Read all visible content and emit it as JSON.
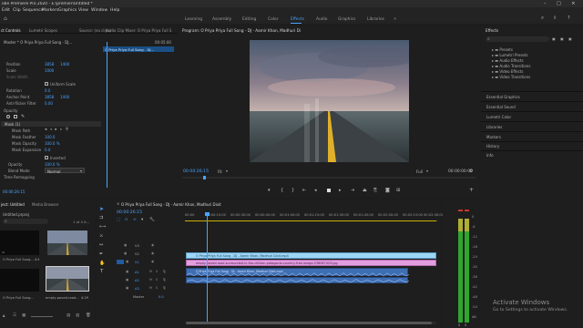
{
  "titlebar": {
    "title": "obe Premiere Pro 2020 - E:\\premier\\Untitled *"
  },
  "menu": [
    "Edit",
    "Clip",
    "Sequence",
    "Markers",
    "Graphics",
    "View",
    "Window",
    "Help"
  ],
  "workspaces": {
    "tabs": [
      "Learning",
      "Assembly",
      "Editing",
      "Color",
      "Effects",
      "Audio",
      "Graphics",
      "Libraries"
    ],
    "active": "Effects"
  },
  "effect_controls": {
    "tabs": [
      "ct Controls",
      "Lumetri Scopes",
      "Source: (no clips)",
      "Audio Clip Mixer: O Priya Priya Full S"
    ],
    "master": "Master * O Priya Priya Full Song - DJ...",
    "clip": "O Priya Priya Full Song - DJ...",
    "timecode": "00:05:00",
    "rows": [
      {
        "label": "Position",
        "v1": "3858",
        "v2": "1400"
      },
      {
        "label": "Scale",
        "v1": "1000",
        "v2": ""
      },
      {
        "label": "Scale Width",
        "v1": "",
        "v2": ""
      },
      {
        "label": "",
        "v1": "",
        "v2": "Uniform Scale"
      },
      {
        "label": "Rotation",
        "v1": "0.0",
        "v2": ""
      },
      {
        "label": "Anchor Point",
        "v1": "3858",
        "v2": "1400"
      },
      {
        "label": "Anti-flicker Filter",
        "v1": "0.00",
        "v2": ""
      }
    ],
    "opacity_label": "Opacity",
    "mask_label": "Mask (1)",
    "mask_rows": [
      {
        "label": "Mask Path",
        "v": ""
      },
      {
        "label": "Mask Feather",
        "v": "100.0"
      },
      {
        "label": "Mask Opacity",
        "v": "100.0 %"
      },
      {
        "label": "Mask Expansion",
        "v": "0.0"
      },
      {
        "label": "",
        "v": "Inverted"
      }
    ],
    "opacity_value_label": "Opacity",
    "opacity_value": "100.0 %",
    "blend_label": "Blend Mode",
    "blend_value": "Normal",
    "time_remap": "Time Remapping",
    "bottom_time": "00:00:26:15"
  },
  "program": {
    "title": "Program: O Priya Priya Full Song - DJ - Aamir Khan, Madhuri Dixit",
    "timecode": "00:00:26:15",
    "fit": "Fit",
    "quality": "Full",
    "duration": "00:00:00:00"
  },
  "project": {
    "tabs": [
      "ject: Untitled",
      "Media Browser"
    ],
    "name": "Untitled.prproj",
    "count": "1 of 4 it...",
    "items": [
      {
        "name": "O Priya Full Song... 4:47:00",
        "thumb": "dark"
      },
      {
        "name": "",
        "thumb": "road"
      },
      {
        "name": "O Priya Full Song...",
        "thumb": "dark"
      },
      {
        "name": "empty-paved-road...",
        "thumb": "road"
      }
    ],
    "durations": [
      "4:47:00",
      "4:29"
    ]
  },
  "timeline": {
    "tab": "O Priya Priya Full Song - DJ - Aamir Khan, Madhuri Dixit",
    "timecode": "00:00:26:15",
    "ruler": [
      "00:00",
      "00:00:15:00",
      "00:00:30:00",
      "00:00:45:00",
      "00:01:00:00",
      "00:01:15:00",
      "00:01:30:00",
      "00:01:45:00",
      "00:02:00:00",
      "00:02:15:00",
      "00:02:30:00"
    ],
    "tracks": [
      "V3",
      "V2",
      "V1",
      "A1",
      "A2",
      "A3",
      "Master"
    ],
    "master_level": "0.0",
    "clip_v2": "O Priya Priya Full Song - DJ - Aamir Khan, Madhuri Dixit.mp4",
    "clip_v1": "empty-paved-road-surrounded-in-the-chilean-patagonia-country-free-image-238087423.jpg",
    "clip_a1": "O Priya Priya Full Song - DJ - Aamir Khan, Madhuri Dixit.mp4"
  },
  "effects_panel": {
    "title": "Effects",
    "search_placeholder": "",
    "folders": [
      "Presets",
      "Lumetri Presets",
      "Audio Effects",
      "Audio Transitions",
      "Video Effects",
      "Video Transitions"
    ],
    "sections": [
      "Essential Graphics",
      "Essential Sound",
      "Lumetri Color",
      "Libraries",
      "Markers",
      "History",
      "Info"
    ]
  },
  "meter": {
    "scale": [
      "0",
      "-6",
      "-12",
      "-18",
      "-24",
      "-30",
      "-36",
      "-42",
      "-48",
      "-54",
      "dB"
    ]
  },
  "watermark": {
    "line1": "Activate Windows",
    "line2": "Go to Settings to activate Windows."
  },
  "colors": {
    "accent": "#4aa3ff",
    "clip_video": "#9dd5f5",
    "clip_image": "#e39ee0",
    "clip_audio": "#4b7cc2",
    "meter": "#2fa62f"
  }
}
